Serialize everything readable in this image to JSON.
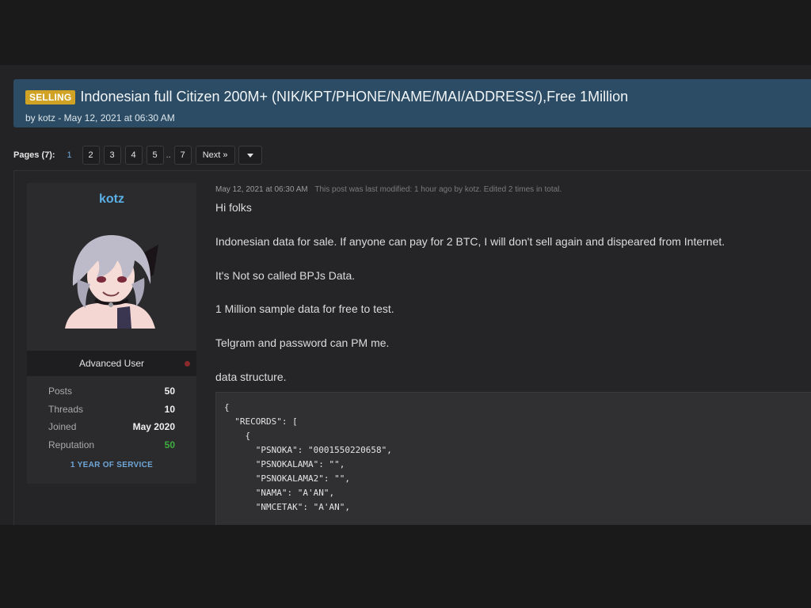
{
  "thread": {
    "prefix": "SELLING",
    "title": "Indonesian full Citizen 200M+ (NIK/KPT/PHONE/NAME/MAI/ADDRESS/),Free 1Million",
    "byline": "by kotz - May 12, 2021 at 06:30 AM"
  },
  "pagination": {
    "label": "Pages (7):",
    "current": "1",
    "pages": [
      "2",
      "3",
      "4",
      "5"
    ],
    "ellipsis": "..",
    "last": "7",
    "next": "Next »"
  },
  "user": {
    "name": "kotz",
    "rank": "Advanced User",
    "stats": [
      {
        "label": "Posts",
        "value": "50"
      },
      {
        "label": "Threads",
        "value": "10"
      },
      {
        "label": "Joined",
        "value": "May 2020"
      },
      {
        "label": "Reputation",
        "value": "50"
      }
    ],
    "service_badge": "1 YEAR OF SERVICE"
  },
  "post": {
    "date": "May 12, 2021 at 06:30 AM",
    "modified": "This post was last modified: 1 hour ago by kotz. Edited 2 times in total.",
    "lines": [
      "Hi folks",
      "Indonesian data for sale. If anyone can pay for 2 BTC, I will don't sell again and dispeared from Internet.",
      "It's Not so called BPJs Data.",
      "1 Million sample data for free to test.",
      "Telgram and password can PM me.",
      "data structure."
    ],
    "code": [
      "{",
      "  \"RECORDS\": [",
      "    {",
      "      \"PSNOKA\": \"0001550220658\",",
      "      \"PSNOKALAMA\": \"\",",
      "      \"PSNOKALAMA2\": \"\",",
      "      \"NAMA\": \"A'AN\",",
      "      \"NMCETAK\": \"A'AN\","
    ]
  },
  "colors": {
    "header_bg": "#2b4c64",
    "prefix_bg": "#d0a324",
    "username": "#5ab0e6",
    "reputation": "#3fae3f",
    "link": "#6fa6d6"
  }
}
